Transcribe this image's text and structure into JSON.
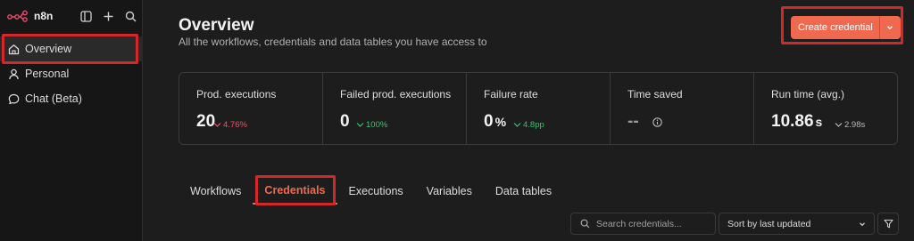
{
  "app": {
    "name": "n8n"
  },
  "sidebar": {
    "items": [
      {
        "label": "Overview",
        "icon": "home-icon",
        "active": true
      },
      {
        "label": "Personal",
        "icon": "user-icon",
        "active": false
      },
      {
        "label": "Chat (Beta)",
        "icon": "chat-icon",
        "active": false
      }
    ]
  },
  "header": {
    "title": "Overview",
    "subtitle": "All the workflows, credentials and data tables you have access to",
    "create_label": "Create credential"
  },
  "stats": [
    {
      "label": "Prod. executions",
      "value": "20",
      "unit": "",
      "delta": "4.76%",
      "trend": "down",
      "delta_color": "#f0506e"
    },
    {
      "label": "Failed prod. executions",
      "value": "0",
      "unit": "",
      "delta": "100%",
      "trend": "down",
      "delta_color": "#3fbf6f"
    },
    {
      "label": "Failure rate",
      "value": "0",
      "unit": "%",
      "delta": "4.8pp",
      "trend": "down",
      "delta_color": "#3fbf6f"
    },
    {
      "label": "Time saved",
      "value": "--",
      "unit": "",
      "delta": "",
      "trend": "",
      "delta_color": ""
    },
    {
      "label": "Run time (avg.)",
      "value": "10.86",
      "unit": "s",
      "delta": "2.98s",
      "trend": "down",
      "delta_color": "#b8b8b8"
    }
  ],
  "tabs": [
    {
      "label": "Workflows",
      "active": false
    },
    {
      "label": "Credentials",
      "active": true
    },
    {
      "label": "Executions",
      "active": false
    },
    {
      "label": "Variables",
      "active": false
    },
    {
      "label": "Data tables",
      "active": false
    }
  ],
  "search": {
    "placeholder": "Search credentials..."
  },
  "sort": {
    "selected": "Sort by last updated"
  },
  "colors": {
    "accent": "#f0694f",
    "highlight": "#d4272a",
    "background": "#1d1d1d",
    "sidebar": "#161616"
  }
}
